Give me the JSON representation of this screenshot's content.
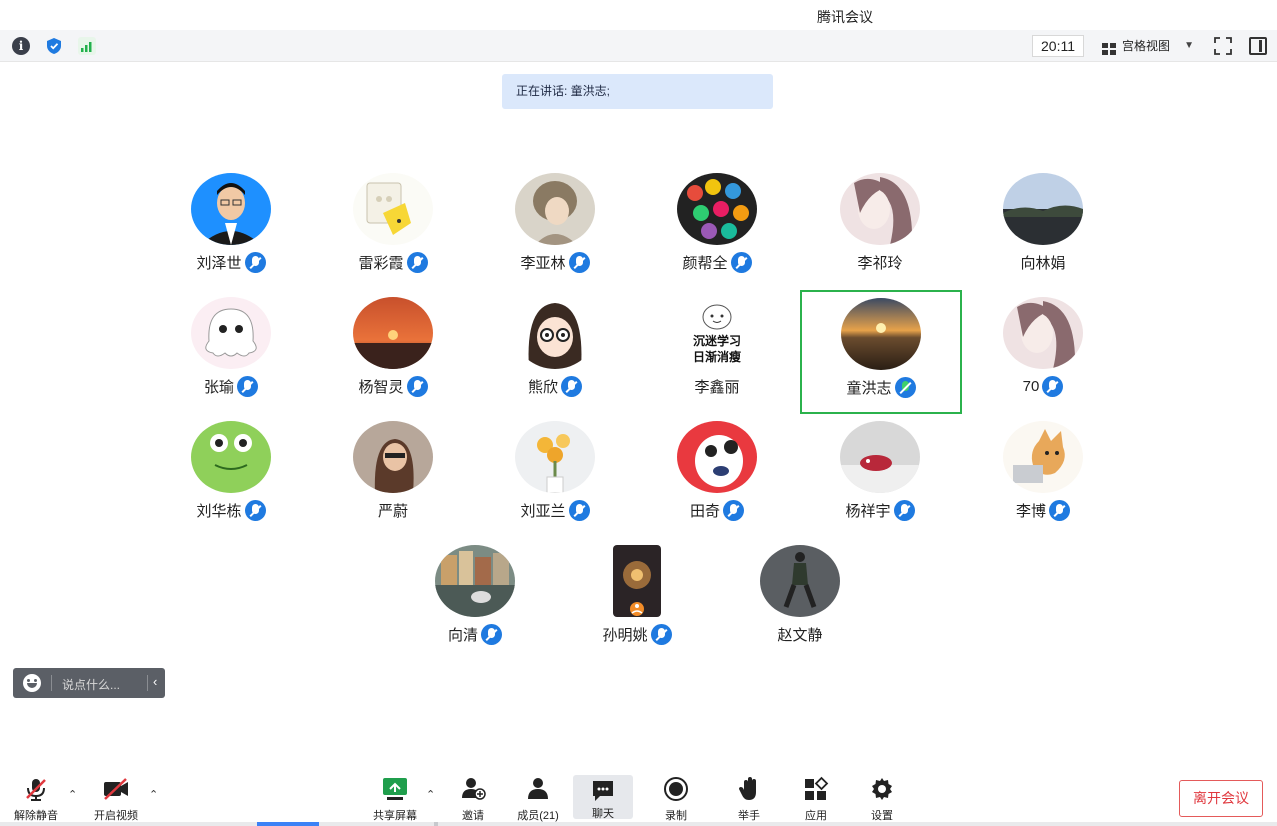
{
  "window": {
    "title": "腾讯会议"
  },
  "status": {
    "time": "20:11",
    "view_mode": "宫格视图"
  },
  "speaking": {
    "text": "正在讲话: 童洪志;"
  },
  "participants": [
    {
      "name": "刘泽世",
      "muted": true
    },
    {
      "name": "雷彩霞",
      "muted": true
    },
    {
      "name": "李亚林",
      "muted": true
    },
    {
      "name": "颜帮全",
      "muted": true
    },
    {
      "name": "李祁玲",
      "muted": false
    },
    {
      "name": "向林娟",
      "muted": false
    },
    {
      "name": "张瑜",
      "muted": true
    },
    {
      "name": "杨智灵",
      "muted": true
    },
    {
      "name": "熊欣",
      "muted": true
    },
    {
      "name": "李鑫丽",
      "muted": false,
      "avatar_text": [
        "沉迷学习",
        "日渐消瘦"
      ]
    },
    {
      "name": "童洪志",
      "muted": false,
      "speaking": true
    },
    {
      "name": "70",
      "muted": true
    },
    {
      "name": "刘华栋",
      "muted": true
    },
    {
      "name": "严蔚",
      "muted": false
    },
    {
      "name": "刘亚兰",
      "muted": true
    },
    {
      "name": "田奇",
      "muted": true
    },
    {
      "name": "杨祥宇",
      "muted": true
    },
    {
      "name": "李博",
      "muted": true
    },
    {
      "name": "向清",
      "muted": true
    },
    {
      "name": "孙明姚",
      "muted": true,
      "host": true
    },
    {
      "name": "赵文静",
      "muted": false
    }
  ],
  "chat": {
    "placeholder": "说点什么..."
  },
  "toolbar": {
    "unmute": "解除静音",
    "start_video": "开启视频",
    "share_screen": "共享屏幕",
    "invite": "邀请",
    "members": "成员(21)",
    "chat": "聊天",
    "record": "录制",
    "raise_hand": "举手",
    "apps": "应用",
    "settings": "设置",
    "leave": "离开会议"
  },
  "colors": {
    "accent": "#1f7ae0",
    "speaking_border": "#2bb24c",
    "leave": "#e0383e"
  }
}
